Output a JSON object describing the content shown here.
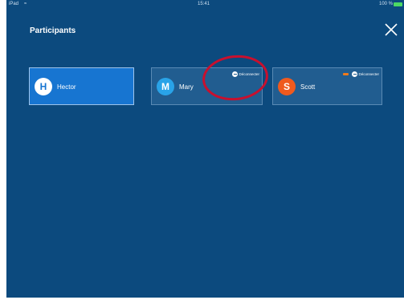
{
  "statusbar": {
    "carrier": "iPad",
    "time": "15:41",
    "battery": "100 %"
  },
  "header": {
    "title": "Participants"
  },
  "participants": [
    {
      "initial": "H",
      "name": "Hector",
      "status": ""
    },
    {
      "initial": "M",
      "name": "Mary",
      "status": "Déconnecter"
    },
    {
      "initial": "S",
      "name": "Scott",
      "status": "Déconnecter"
    }
  ],
  "colors": {
    "background": "#0c4a7e",
    "card": "#215d90",
    "active_card": "#1775d1",
    "annotation": "#c8102e"
  }
}
